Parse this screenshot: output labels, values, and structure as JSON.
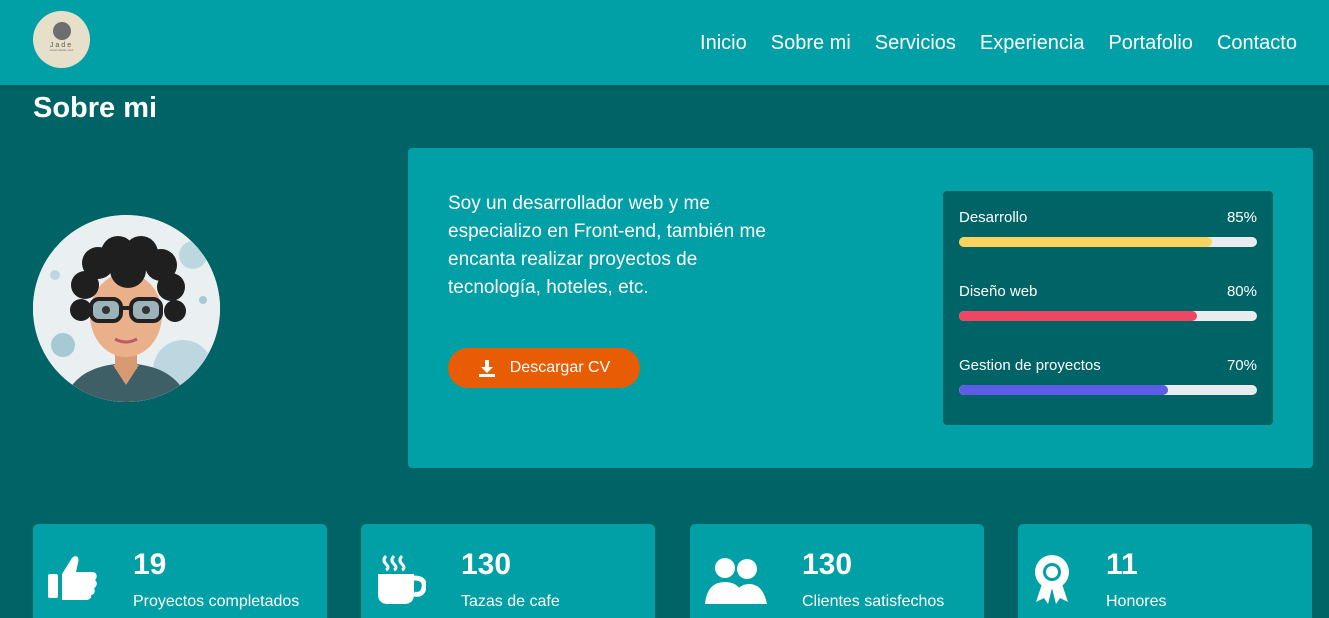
{
  "brand": {
    "logo_text": "Jade",
    "logo_subtext": "desarrollador web"
  },
  "nav": {
    "items": [
      {
        "label": "Inicio"
      },
      {
        "label": "Sobre mi"
      },
      {
        "label": "Servicios"
      },
      {
        "label": "Experiencia"
      },
      {
        "label": "Portafolio"
      },
      {
        "label": "Contacto"
      }
    ]
  },
  "about": {
    "title": "Sobre mi",
    "description": "Soy un desarrollador web y me especializo en Front-end, también me encanta realizar proyectos de tecnología, hoteles, etc.",
    "cv_button_label": "Descargar CV",
    "cv_icon": "download-icon"
  },
  "skills": [
    {
      "name": "Desarrollo",
      "percent_label": "85%",
      "value": 85,
      "color": "#F9D35B"
    },
    {
      "name": "Diseño web",
      "percent_label": "80%",
      "value": 80,
      "color": "#EF4763"
    },
    {
      "name": "Gestion de proyectos",
      "percent_label": "70%",
      "value": 70,
      "color": "#5E5CE6"
    }
  ],
  "stats": [
    {
      "number": "19",
      "label": "Proyectos completados",
      "icon": "thumbs-up-icon"
    },
    {
      "number": "130",
      "label": "Tazas de cafe",
      "icon": "coffee-cup-icon"
    },
    {
      "number": "130",
      "label": "Clientes satisfechos",
      "icon": "users-icon"
    },
    {
      "number": "11",
      "label": "Honores",
      "icon": "award-icon"
    }
  ],
  "colors": {
    "background": "#006466",
    "primary": "#00A0A6",
    "accent": "#E85D04"
  }
}
